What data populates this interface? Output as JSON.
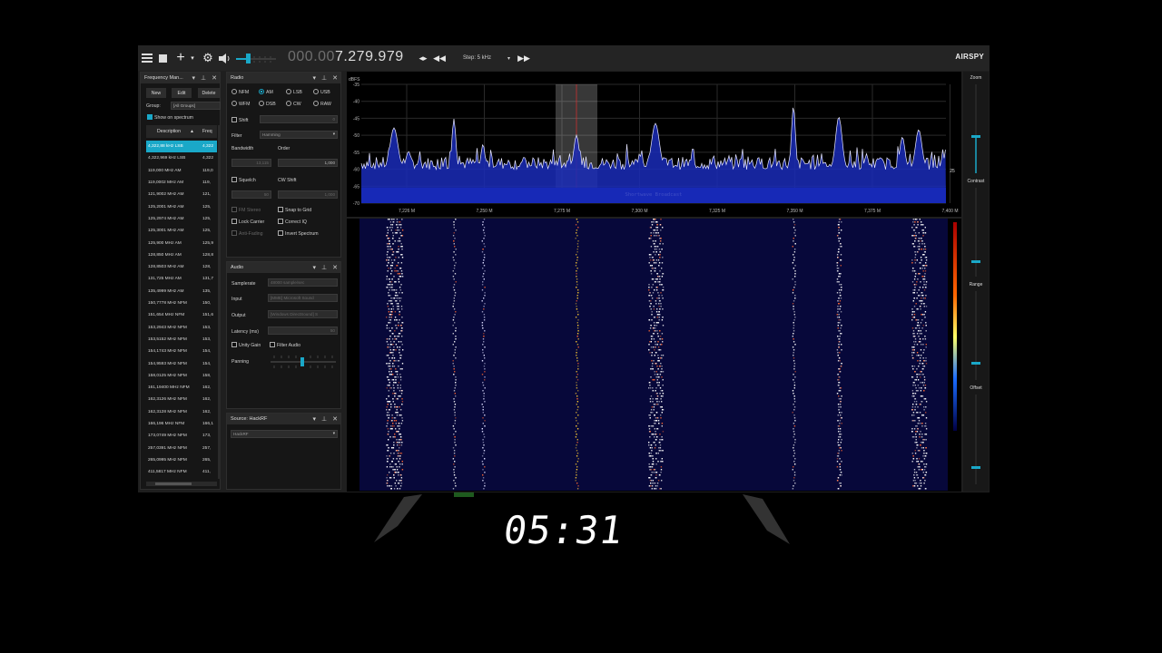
{
  "toolbar": {
    "menu_icon": "hamburger-menu-icon",
    "frequency_dim": "000.00",
    "frequency_main": "7.279.979",
    "step_label": "Step: 5 kHz",
    "brand": "AIRSPY"
  },
  "freq_manager": {
    "title": "Frequency Man...",
    "buttons": {
      "new": "New",
      "edit": "Edit",
      "delete": "Delete"
    },
    "group_label": "Group:",
    "group_value": "[All Groups]",
    "show_on_spectrum": "Show on spectrum",
    "col_description": "Description",
    "col_freq": "Freq",
    "rows": [
      {
        "desc": "4,322,88 kHz LSB",
        "freq": "4,322"
      },
      {
        "desc": "4,322,969 kHz LSB",
        "freq": "4,322"
      },
      {
        "desc": "119,000 MHz AM",
        "freq": "119,0"
      },
      {
        "desc": "119,0002 MHz AM",
        "freq": "119,"
      },
      {
        "desc": "121,9002 MHz AM",
        "freq": "121,"
      },
      {
        "desc": "125,2001 MHz AM",
        "freq": "125,"
      },
      {
        "desc": "125,2974 MHz AM",
        "freq": "125,"
      },
      {
        "desc": "125,3001 MHz AM",
        "freq": "125,"
      },
      {
        "desc": "125,900 MHz AM",
        "freq": "125,9"
      },
      {
        "desc": "128,850 MHz AM",
        "freq": "128,8"
      },
      {
        "desc": "128,8503 MHz AM",
        "freq": "128,"
      },
      {
        "desc": "131,725 MHz AM",
        "freq": "131,7"
      },
      {
        "desc": "135,4999 MHz AM",
        "freq": "135,"
      },
      {
        "desc": "150,7778 MHz NFM",
        "freq": "150,"
      },
      {
        "desc": "151,654 MHz NFM",
        "freq": "151,6"
      },
      {
        "desc": "153,2943 MHz NFM",
        "freq": "153,"
      },
      {
        "desc": "153,5152 MHz NFM",
        "freq": "153,"
      },
      {
        "desc": "154,1743 MHz NFM",
        "freq": "154,"
      },
      {
        "desc": "154,9593 MHz NFM",
        "freq": "154,"
      },
      {
        "desc": "158,0125 MHz NFM",
        "freq": "158,"
      },
      {
        "desc": "161,19400 MHz NFM",
        "freq": "162,"
      },
      {
        "desc": "162,3126 MHz NFM",
        "freq": "162,"
      },
      {
        "desc": "162,3128 MHz NFM",
        "freq": "162,"
      },
      {
        "desc": "166,196 MHz NFM",
        "freq": "166,1"
      },
      {
        "desc": "173,0749 MHz NFM",
        "freq": "173,"
      },
      {
        "desc": "257,0391 MHz NFM",
        "freq": "257,"
      },
      {
        "desc": "265,0995 MHz NFM",
        "freq": "265,"
      },
      {
        "desc": "411,5817 MHz NFM",
        "freq": "411,"
      }
    ]
  },
  "radio": {
    "title": "Radio",
    "modes": [
      "NFM",
      "AM",
      "LSB",
      "USB",
      "WFM",
      "DSB",
      "CW",
      "RAW"
    ],
    "selected_mode": "AM",
    "shift_label": "Shift",
    "shift_value": "0",
    "filter_label": "Filter",
    "filter_value": "Hamming",
    "bandwidth_label": "Bandwidth",
    "order_label": "Order",
    "bandwidth_value": "13,115",
    "order_value": "1,000",
    "squelch_label": "Squelch",
    "cw_shift_label": "CW Shift",
    "squelch_value": "50",
    "cw_shift_value": "1,000",
    "fm_stereo": "FM Stereo",
    "snap_to_grid": "Snap to Grid",
    "lock_carrier": "Lock Carrier",
    "correct_iq": "Correct IQ",
    "anti_fading": "Anti-Fading",
    "invert_spectrum": "Invert Spectrum"
  },
  "audio": {
    "title": "Audio",
    "samplerate_label": "Samplerate",
    "samplerate_value": "48000 sample/sec",
    "input_label": "Input",
    "input_value": "[MME] Microsoft Sound",
    "output_label": "Output",
    "output_value": "[Windows DirectSound] S",
    "latency_label": "Latency (ms)",
    "latency_value": "50",
    "unity_gain": "Unity Gain",
    "filter_audio": "Filter Audio",
    "panning_label": "Panning"
  },
  "source": {
    "title": "Source: HackRF",
    "device": "HackRF"
  },
  "spectrum": {
    "unit": "dBFS",
    "y_ticks": [
      "-35",
      "-40",
      "-45",
      "-50",
      "-55",
      "-60",
      "-65",
      "-70"
    ],
    "x_ticks": [
      "7,226 M",
      "7,250 M",
      "7,275 M",
      "7,300 M",
      "7,325 M",
      "7,350 M",
      "7,375 M",
      "7,400 M"
    ],
    "band_label": "Shortwave Broadcast",
    "right_value": "25"
  },
  "sliders": {
    "zoom": "Zoom",
    "contrast": "Contrast",
    "range": "Range",
    "offset": "Offset"
  },
  "overlay": {
    "clock": "05:31"
  },
  "colors": {
    "accent": "#1aa8c8",
    "spectrum_fill": "#1a2bb8",
    "waterfall_bg": "#0a0a4a"
  }
}
